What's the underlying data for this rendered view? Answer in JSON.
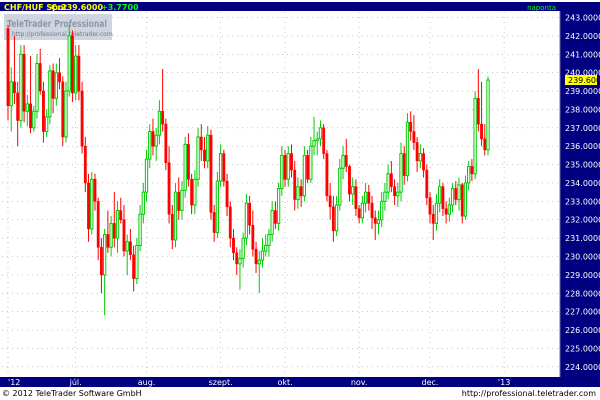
{
  "header": {
    "symbol": "CHF/HUF Spot",
    "close_label": "C:",
    "close_value": "239.6000",
    "change": "+3.7700",
    "period": "naponta"
  },
  "logo": {
    "name": "TeleTrader Professional",
    "url": "http://professional.teletrader.com"
  },
  "footer": {
    "copyright": "© 2012 TeleTrader Software GmbH",
    "url": "http://professional.teletrader.com"
  },
  "last_price_label": "239.6000",
  "colors": {
    "background": "#ffffff",
    "axis_bar": "#000080",
    "up": "#00cc00",
    "down": "#ff0000",
    "last_marker": "#ffff00",
    "grid": "#a0a0a0"
  },
  "chart_data": {
    "type": "candlestick",
    "ylim": [
      223.5,
      243.3
    ],
    "y_ticks": [
      "224.0000",
      "225.0000",
      "226.0000",
      "227.0000",
      "228.0000",
      "229.0000",
      "230.0000",
      "231.0000",
      "232.0000",
      "233.0000",
      "234.0000",
      "235.0000",
      "236.0000",
      "237.0000",
      "238.0000",
      "239.0000",
      "240.0000",
      "241.0000",
      "242.0000",
      "243.0000"
    ],
    "x_labels": [
      {
        "label": "'12",
        "day": 0
      },
      {
        "label": "júl.",
        "day": 21
      },
      {
        "label": "aug.",
        "day": 43
      },
      {
        "label": "szept.",
        "day": 66
      },
      {
        "label": "okt.",
        "day": 86
      },
      {
        "label": "nov.",
        "day": 109
      },
      {
        "label": "dec.",
        "day": 131
      },
      {
        "label": "'13",
        "day": 154
      }
    ],
    "grid": true,
    "candles": [
      [
        242.4,
        242.6,
        237.4,
        238.2
      ],
      [
        238.2,
        240.3,
        236.8,
        239.5
      ],
      [
        239.5,
        242.0,
        238.3,
        238.9
      ],
      [
        238.9,
        239.5,
        236.0,
        237.4
      ],
      [
        237.4,
        241.5,
        237.0,
        241.0
      ],
      [
        241.0,
        241.5,
        237.3,
        237.9
      ],
      [
        237.9,
        238.8,
        237.1,
        238.3
      ],
      [
        238.3,
        240.9,
        236.7,
        237.0
      ],
      [
        237.0,
        238.2,
        236.8,
        237.9
      ],
      [
        237.9,
        241.0,
        237.5,
        240.5
      ],
      [
        240.5,
        241.3,
        238.8,
        239.0
      ],
      [
        239.0,
        239.5,
        236.2,
        236.8
      ],
      [
        236.8,
        238.0,
        236.5,
        237.6
      ],
      [
        237.6,
        240.4,
        237.2,
        240.1
      ],
      [
        240.1,
        240.5,
        237.8,
        238.6
      ],
      [
        238.6,
        240.5,
        238.2,
        240.0
      ],
      [
        240.0,
        240.8,
        239.1,
        239.5
      ],
      [
        239.5,
        239.8,
        236.0,
        236.5
      ],
      [
        236.5,
        239.5,
        236.2,
        239.0
      ],
      [
        239.0,
        242.6,
        238.7,
        242.0
      ],
      [
        242.0,
        242.3,
        238.4,
        238.9
      ],
      [
        238.9,
        241.5,
        238.5,
        240.9
      ],
      [
        240.9,
        241.5,
        238.5,
        239.0
      ],
      [
        239.0,
        239.5,
        235.6,
        236.0
      ],
      [
        236.0,
        236.5,
        233.5,
        234.0
      ],
      [
        234.0,
        234.5,
        230.8,
        231.5
      ],
      [
        231.5,
        234.6,
        231.2,
        234.2
      ],
      [
        234.2,
        234.5,
        232.5,
        233.0
      ],
      [
        233.0,
        233.2,
        229.8,
        230.5
      ],
      [
        230.5,
        231.0,
        228.0,
        229.0
      ],
      [
        229.0,
        231.5,
        226.8,
        231.2
      ],
      [
        231.2,
        232.5,
        230.2,
        230.5
      ],
      [
        230.5,
        232.2,
        230.0,
        231.8
      ],
      [
        231.8,
        233.5,
        230.5,
        231.0
      ],
      [
        231.0,
        233.0,
        230.2,
        232.5
      ],
      [
        232.5,
        233.2,
        231.8,
        232.0
      ],
      [
        232.0,
        232.8,
        230.0,
        230.3
      ],
      [
        230.3,
        231.2,
        229.0,
        230.8
      ],
      [
        230.8,
        231.5,
        229.8,
        230.1
      ],
      [
        230.1,
        230.6,
        228.1,
        228.8
      ],
      [
        228.8,
        231.0,
        228.5,
        230.6
      ],
      [
        230.6,
        232.8,
        230.3,
        232.3
      ],
      [
        232.3,
        234.0,
        231.8,
        233.5
      ],
      [
        233.5,
        235.8,
        233.0,
        235.3
      ],
      [
        235.3,
        237.2,
        234.8,
        236.8
      ],
      [
        236.8,
        237.5,
        235.5,
        236.0
      ],
      [
        236.0,
        237.0,
        235.2,
        236.6
      ],
      [
        236.6,
        238.5,
        236.1,
        237.9
      ],
      [
        237.9,
        240.2,
        236.8,
        237.2
      ],
      [
        237.2,
        237.5,
        234.7,
        235.1
      ],
      [
        235.1,
        236.0,
        231.8,
        232.3
      ],
      [
        232.3,
        232.8,
        230.4,
        230.9
      ],
      [
        230.9,
        234.0,
        230.5,
        233.5
      ],
      [
        233.5,
        234.3,
        232.0,
        232.5
      ],
      [
        232.5,
        234.1,
        232.0,
        233.6
      ],
      [
        233.6,
        236.5,
        233.2,
        236.1
      ],
      [
        236.1,
        236.7,
        233.8,
        234.2
      ],
      [
        234.2,
        234.5,
        232.3,
        232.8
      ],
      [
        232.8,
        234.7,
        232.3,
        234.2
      ],
      [
        234.2,
        237.0,
        233.8,
        236.5
      ],
      [
        236.5,
        237.2,
        235.2,
        235.8
      ],
      [
        235.8,
        236.5,
        234.8,
        235.2
      ],
      [
        235.2,
        237.1,
        234.8,
        236.6
      ],
      [
        236.6,
        236.9,
        232.0,
        232.4
      ],
      [
        232.4,
        232.8,
        230.8,
        231.3
      ],
      [
        231.3,
        234.6,
        231.0,
        234.1
      ],
      [
        234.1,
        236.1,
        233.8,
        235.6
      ],
      [
        235.6,
        235.8,
        233.8,
        234.1
      ],
      [
        234.1,
        234.5,
        232.2,
        232.7
      ],
      [
        232.7,
        233.0,
        230.5,
        231.0
      ],
      [
        231.0,
        231.5,
        229.8,
        230.2
      ],
      [
        230.2,
        230.5,
        229.0,
        229.6
      ],
      [
        229.6,
        230.4,
        228.2,
        229.9
      ],
      [
        229.9,
        231.3,
        229.4,
        231.0
      ],
      [
        231.0,
        233.4,
        230.6,
        232.9
      ],
      [
        232.9,
        233.3,
        231.2,
        231.7
      ],
      [
        231.7,
        232.5,
        230.0,
        230.4
      ],
      [
        230.4,
        230.8,
        229.1,
        229.6
      ],
      [
        229.6,
        230.3,
        228.0,
        229.8
      ],
      [
        229.8,
        231.0,
        229.4,
        230.3
      ],
      [
        230.3,
        231.2,
        230.0,
        230.6
      ],
      [
        230.6,
        231.5,
        230.0,
        231.2
      ],
      [
        231.2,
        233.0,
        230.8,
        232.5
      ],
      [
        232.5,
        233.0,
        231.5,
        231.8
      ],
      [
        231.8,
        234.0,
        231.4,
        233.7
      ],
      [
        233.7,
        236.0,
        233.3,
        235.5
      ],
      [
        235.5,
        235.8,
        233.8,
        234.2
      ],
      [
        234.2,
        236.0,
        233.8,
        235.6
      ],
      [
        235.6,
        236.1,
        234.3,
        234.7
      ],
      [
        234.7,
        235.2,
        232.5,
        233.1
      ],
      [
        233.1,
        234.3,
        232.6,
        233.8
      ],
      [
        233.8,
        234.2,
        232.7,
        233.3
      ],
      [
        233.3,
        236.0,
        233.0,
        235.5
      ],
      [
        235.5,
        235.8,
        234.0,
        234.2
      ],
      [
        234.2,
        236.5,
        234.0,
        236.0
      ],
      [
        236.0,
        237.6,
        235.5,
        236.3
      ],
      [
        236.3,
        236.8,
        235.5,
        236.4
      ],
      [
        236.4,
        237.4,
        236.0,
        237.0
      ],
      [
        237.0,
        237.2,
        235.3,
        235.6
      ],
      [
        235.6,
        235.8,
        233.0,
        233.3
      ],
      [
        233.3,
        234.0,
        232.0,
        232.7
      ],
      [
        232.7,
        233.3,
        230.8,
        231.4
      ],
      [
        231.4,
        233.3,
        231.1,
        232.8
      ],
      [
        232.8,
        235.3,
        232.5,
        234.8
      ],
      [
        234.8,
        236.0,
        234.2,
        235.5
      ],
      [
        235.5,
        236.4,
        234.6,
        234.9
      ],
      [
        234.9,
        235.0,
        233.0,
        233.4
      ],
      [
        233.4,
        234.3,
        232.8,
        233.8
      ],
      [
        233.8,
        234.2,
        232.2,
        232.6
      ],
      [
        232.6,
        232.8,
        231.8,
        232.1
      ],
      [
        232.1,
        233.3,
        231.8,
        232.9
      ],
      [
        232.9,
        234.0,
        232.4,
        233.5
      ],
      [
        233.5,
        233.9,
        232.5,
        232.9
      ],
      [
        232.9,
        233.3,
        231.5,
        232.1
      ],
      [
        232.1,
        232.5,
        230.9,
        231.8
      ],
      [
        231.8,
        232.5,
        231.2,
        232.0
      ],
      [
        232.0,
        233.5,
        231.6,
        233.0
      ],
      [
        233.0,
        234.0,
        232.5,
        233.5
      ],
      [
        233.5,
        235.0,
        233.1,
        234.5
      ],
      [
        234.5,
        235.2,
        233.5,
        233.8
      ],
      [
        233.8,
        234.2,
        232.8,
        233.3
      ],
      [
        233.3,
        234.0,
        232.7,
        233.5
      ],
      [
        233.5,
        236.2,
        233.0,
        235.6
      ],
      [
        235.6,
        236.0,
        233.9,
        234.4
      ],
      [
        234.4,
        237.8,
        234.1,
        237.3
      ],
      [
        237.3,
        237.9,
        236.3,
        236.8
      ],
      [
        236.8,
        237.7,
        235.8,
        236.2
      ],
      [
        236.2,
        236.5,
        234.6,
        235.2
      ],
      [
        235.2,
        236.1,
        234.8,
        235.6
      ],
      [
        235.6,
        235.9,
        234.3,
        234.7
      ],
      [
        234.7,
        235.0,
        232.8,
        233.2
      ],
      [
        233.2,
        233.5,
        231.8,
        232.3
      ],
      [
        232.3,
        232.8,
        230.9,
        231.8
      ],
      [
        231.8,
        233.4,
        231.4,
        232.9
      ],
      [
        232.9,
        234.2,
        232.4,
        233.8
      ],
      [
        233.8,
        234.0,
        232.2,
        232.6
      ],
      [
        232.6,
        233.0,
        231.8,
        232.3
      ],
      [
        232.3,
        233.2,
        231.9,
        232.8
      ],
      [
        232.8,
        234.0,
        232.4,
        233.7
      ],
      [
        233.7,
        234.1,
        232.8,
        233.1
      ],
      [
        233.1,
        234.3,
        232.5,
        233.9
      ],
      [
        233.9,
        234.0,
        231.8,
        232.2
      ],
      [
        232.2,
        234.4,
        232.0,
        234.0
      ],
      [
        234.0,
        235.2,
        233.6,
        234.9
      ],
      [
        234.9,
        235.3,
        234.1,
        234.5
      ],
      [
        234.5,
        239.0,
        234.2,
        238.6
      ],
      [
        238.6,
        240.2,
        236.8,
        237.2
      ],
      [
        237.2,
        239.5,
        236.0,
        236.4
      ],
      [
        236.4,
        237.2,
        235.5,
        235.8
      ],
      [
        235.8,
        239.8,
        235.5,
        239.6
      ]
    ]
  }
}
